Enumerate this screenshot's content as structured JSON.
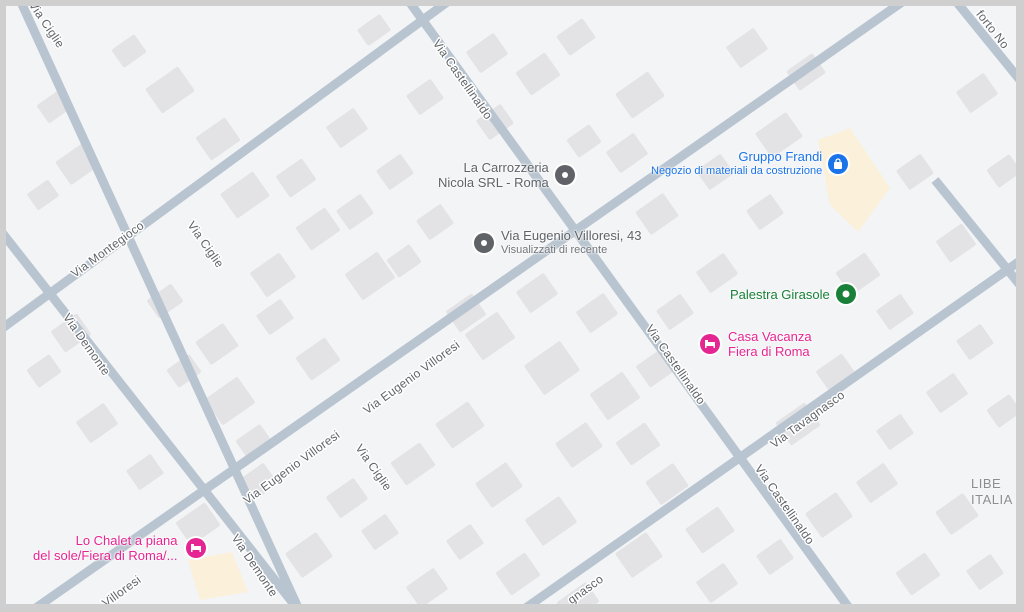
{
  "colors": {
    "background": "#f3f4f6",
    "road": "#b8c4cf",
    "building": "#e3e3e5",
    "land_highlight": "#fbf0d9",
    "poi_gray": "#5f6368",
    "poi_blue": "#1a73e8",
    "poi_green": "#188038",
    "poi_pink": "#e52592"
  },
  "streets": [
    "Via Ciglie",
    "Via Castellinaldo",
    "Via Montegioco",
    "Via Ciglie",
    "Via Demonte",
    "Via Eugenio Villoresi",
    "Via Castellinaldo",
    "Via Tavagnasco",
    "Via Ciglie",
    "Via Eugenio Villoresi",
    "Via Castellinaldo",
    "Via Demonte",
    "Villoresi",
    "gnasco",
    "forto No"
  ],
  "pois": {
    "carrozzeria": {
      "name": "La Carrozzeria\nNicola SRL - Roma",
      "icon": "place-pin-icon"
    },
    "villoresi": {
      "name": "Via Eugenio Villoresi, 43",
      "subtitle": "Visualizzati di recente",
      "icon": "place-pin-icon"
    },
    "frandi": {
      "name": "Gruppo Frandi",
      "subtitle": "Negozio di materiali da costruzione",
      "icon": "shopping-bag-icon"
    },
    "palestra": {
      "name": "Palestra Girasole",
      "icon": "gym-icon"
    },
    "casa_vacanza": {
      "name": "Casa Vacanza\nFiera di Roma",
      "icon": "bed-icon"
    },
    "chalet": {
      "name": "Lo Chalet a piana\ndel sole/Fiera di Roma/...",
      "icon": "bed-icon"
    }
  },
  "area_label": "LIBE\nITALIA"
}
